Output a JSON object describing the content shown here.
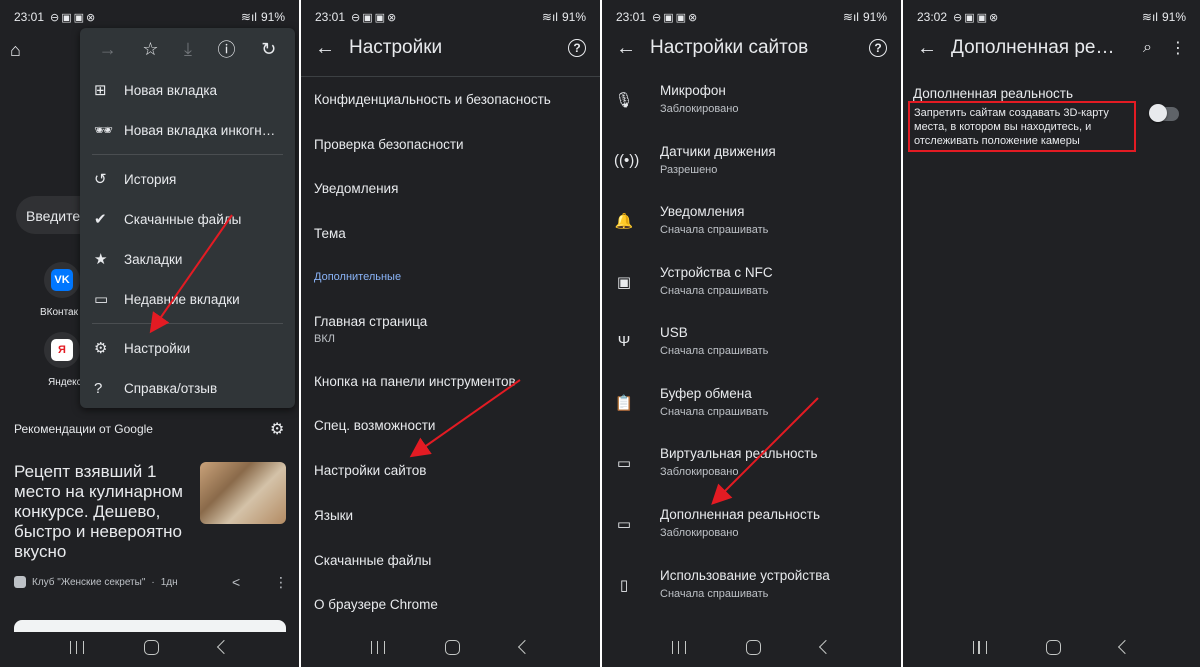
{
  "status_bars": [
    {
      "time": "23:01",
      "battery": "91%"
    },
    {
      "time": "23:01",
      "battery": "91%"
    },
    {
      "time": "23:01",
      "battery": "91%"
    },
    {
      "time": "23:02",
      "battery": "91%"
    }
  ],
  "panel1": {
    "search_placeholder": "Введите",
    "shortcuts": [
      {
        "label": "ВКонтак",
        "logo": "VK",
        "color": "#0077ff"
      },
      {
        "label": "Яндекс",
        "logo": "Я",
        "color": "#ffffff"
      }
    ],
    "recommendations_title": "Рекомендации от Google",
    "article_title": "Рецепт взявший 1 место на кулинарном конкурсе. Дешево, быстро и невероятно вкусно",
    "article_source": "Клуб \"Женские секреты\"",
    "article_age": "1дн",
    "menu": {
      "items": [
        {
          "label": "Новая вкладка",
          "icon": "plus-box-icon"
        },
        {
          "label": "Новая вкладка инкогн…",
          "icon": "incognito-icon"
        },
        {
          "label": "История",
          "icon": "history-icon"
        },
        {
          "label": "Скачанные файлы",
          "icon": "download-check-icon"
        },
        {
          "label": "Закладки",
          "icon": "star-icon"
        },
        {
          "label": "Недавние вкладки",
          "icon": "devices-icon"
        },
        {
          "label": "Настройки",
          "icon": "gear-icon"
        },
        {
          "label": "Справка/отзыв",
          "icon": "help-icon"
        }
      ]
    }
  },
  "panel2": {
    "title": "Настройки",
    "items": [
      {
        "label": "Конфиденциальность и безопасность"
      },
      {
        "label": "Проверка безопасности"
      },
      {
        "label": "Уведомления"
      },
      {
        "label": "Тема"
      }
    ],
    "section_label": "Дополнительные",
    "items2": [
      {
        "label": "Главная страница",
        "sub": "ВКЛ"
      },
      {
        "label": "Кнопка на панели инструментов"
      },
      {
        "label": "Спец. возможности"
      },
      {
        "label": "Настройки сайтов"
      },
      {
        "label": "Языки"
      },
      {
        "label": "Скачанные файлы"
      },
      {
        "label": "О браузере Chrome"
      }
    ]
  },
  "panel3": {
    "title": "Настройки сайтов",
    "items": [
      {
        "label": "Микрофон",
        "status": "Заблокировано",
        "icon": "microphone-icon"
      },
      {
        "label": "Датчики движения",
        "status": "Разрешено",
        "icon": "motion-sensor-icon"
      },
      {
        "label": "Уведомления",
        "status": "Сначала спрашивать",
        "icon": "bell-icon"
      },
      {
        "label": "Устройства с NFC",
        "status": "Сначала спрашивать",
        "icon": "nfc-icon"
      },
      {
        "label": "USB",
        "status": "Сначала спрашивать",
        "icon": "usb-icon"
      },
      {
        "label": "Буфер обмена",
        "status": "Сначала спрашивать",
        "icon": "clipboard-icon"
      },
      {
        "label": "Виртуальная реальность",
        "status": "Заблокировано",
        "icon": "vr-headset-icon"
      },
      {
        "label": "Дополненная реальность",
        "status": "Заблокировано",
        "icon": "ar-headset-icon"
      },
      {
        "label": "Использование устройства",
        "status": "Сначала спрашивать",
        "icon": "device-use-icon"
      }
    ]
  },
  "panel4": {
    "title": "Дополненная ре…",
    "setting_title": "Дополненная реальность",
    "setting_desc": "Запретить сайтам создавать 3D-карту места, в котором вы находитесь, и отслеживать положение камеры",
    "toggle_on": false
  },
  "colors": {
    "background": "#202124",
    "accent": "#8ab4f8",
    "annotation": "#e31b23"
  }
}
